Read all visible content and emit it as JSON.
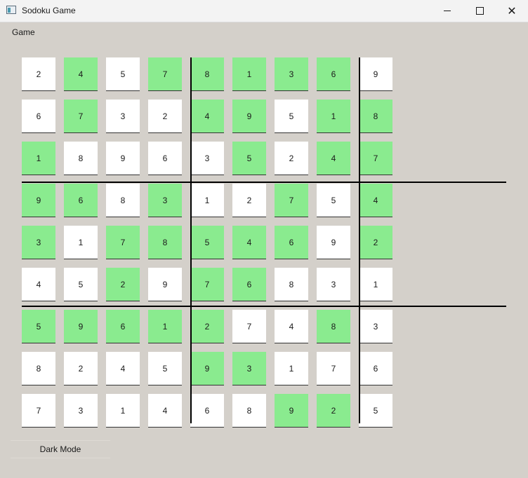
{
  "window": {
    "title": "Sodoku Game"
  },
  "menu": {
    "game": "Game"
  },
  "controls": {
    "dark_mode": "Dark Mode"
  },
  "board": {
    "rows": [
      [
        2,
        4,
        5,
        7,
        8,
        1,
        3,
        6,
        9
      ],
      [
        6,
        7,
        3,
        2,
        4,
        9,
        5,
        1,
        8
      ],
      [
        1,
        8,
        9,
        6,
        3,
        5,
        2,
        4,
        7
      ],
      [
        9,
        6,
        8,
        3,
        1,
        2,
        7,
        5,
        4
      ],
      [
        3,
        1,
        7,
        8,
        5,
        4,
        6,
        9,
        2
      ],
      [
        4,
        5,
        2,
        9,
        7,
        6,
        8,
        3,
        1
      ],
      [
        5,
        9,
        6,
        1,
        2,
        7,
        4,
        8,
        3
      ],
      [
        8,
        2,
        4,
        5,
        9,
        3,
        1,
        7,
        6
      ],
      [
        7,
        3,
        1,
        4,
        6,
        8,
        9,
        2,
        5
      ]
    ],
    "highlighted": [
      [
        0,
        1,
        0,
        1,
        1,
        1,
        1,
        1,
        0
      ],
      [
        0,
        1,
        0,
        0,
        1,
        1,
        0,
        1,
        1
      ],
      [
        1,
        0,
        0,
        0,
        0,
        1,
        0,
        1,
        1
      ],
      [
        1,
        1,
        0,
        1,
        0,
        0,
        1,
        0,
        1
      ],
      [
        1,
        0,
        1,
        1,
        1,
        1,
        1,
        0,
        1
      ],
      [
        0,
        0,
        1,
        0,
        1,
        1,
        0,
        0,
        0
      ],
      [
        1,
        1,
        1,
        1,
        1,
        0,
        0,
        1,
        0
      ],
      [
        0,
        0,
        0,
        0,
        1,
        1,
        0,
        0,
        0
      ],
      [
        0,
        0,
        0,
        0,
        0,
        0,
        1,
        1,
        0
      ]
    ]
  }
}
